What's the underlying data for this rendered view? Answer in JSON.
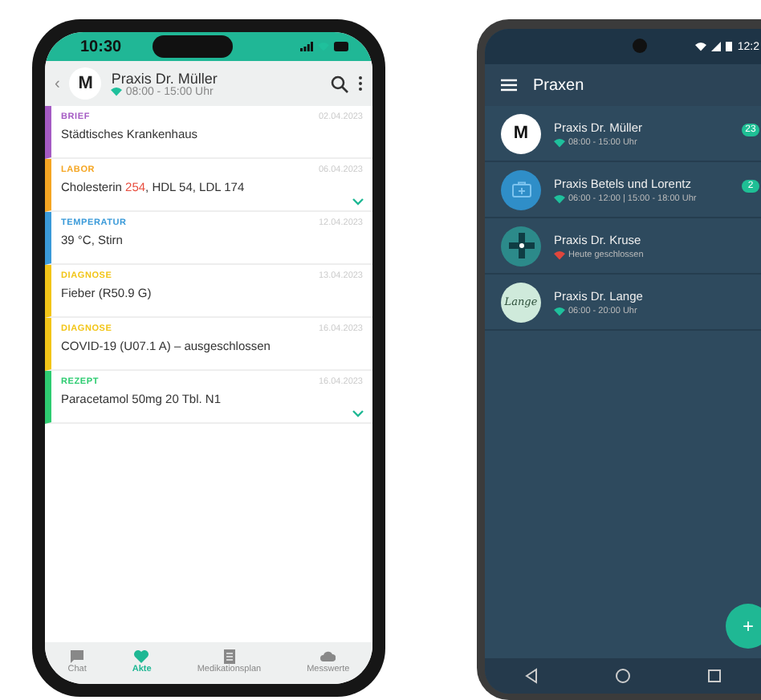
{
  "phone_left": {
    "status_bar": {
      "time": "10:30"
    },
    "header": {
      "back": "‹",
      "avatar": "M",
      "title": "Praxis Dr. Müller",
      "hours": "08:00 - 15:00 Uhr",
      "open": true
    },
    "entries": [
      {
        "category": "BRIEF",
        "color": "#a55bc4",
        "date": "02.04.2023",
        "parts": [
          {
            "text": "Städtisches Krankenhaus",
            "flagged": false
          }
        ],
        "expandable": false
      },
      {
        "category": "LABOR",
        "color": "#f5a623",
        "date": "06.04.2023",
        "parts": [
          {
            "text": "Cholesterin ",
            "flagged": false
          },
          {
            "text": "254",
            "flagged": true
          },
          {
            "text": ", HDL 54, LDL 174",
            "flagged": false
          }
        ],
        "expandable": true
      },
      {
        "category": "TEMPERATUR",
        "color": "#3a9ad9",
        "date": "12.04.2023",
        "parts": [
          {
            "text": "39 °C, Stirn",
            "flagged": false
          }
        ],
        "expandable": false
      },
      {
        "category": "DIAGNOSE",
        "color": "#f2c518",
        "date": "13.04.2023",
        "parts": [
          {
            "text": "Fieber (R50.9 G)",
            "flagged": false
          }
        ],
        "expandable": false
      },
      {
        "category": "DIAGNOSE",
        "color": "#f2c518",
        "date": "16.04.2023",
        "parts": [
          {
            "text": "COVID-19 (U07.1 A) – ausgeschlossen",
            "flagged": false
          }
        ],
        "expandable": false
      },
      {
        "category": "REZEPT",
        "color": "#2ecc71",
        "date": "16.04.2023",
        "parts": [
          {
            "text": "Paracetamol 50mg 20 Tbl. N1",
            "flagged": false
          }
        ],
        "expandable": true
      }
    ],
    "tabs": [
      {
        "kind": "chat",
        "label": "Chat",
        "selected": false
      },
      {
        "kind": "heart",
        "label": "Akte",
        "selected": true
      },
      {
        "kind": "list",
        "label": "Medikationsplan",
        "selected": false
      },
      {
        "kind": "cloud",
        "label": "Messwerte",
        "selected": false
      }
    ]
  },
  "phone_right": {
    "status_bar": {
      "time": "12:2"
    },
    "title": "Praxen",
    "practices": [
      {
        "kind": "letter",
        "avatar_text": "M",
        "name": "Praxis Dr. Müller",
        "hours": "08:00 - 15:00 Uhr",
        "open": true,
        "badge": "23"
      },
      {
        "kind": "case",
        "name": "Praxis Betels und Lorentz",
        "hours": "06:00 - 12:00 | 15:00 - 18:00 Uhr",
        "open": true,
        "badge": "2"
      },
      {
        "kind": "cross",
        "name": "Praxis Dr. Kruse",
        "hours": "Heute geschlossen",
        "open": false
      },
      {
        "kind": "logo",
        "avatar_text": "Lange",
        "name": "Praxis Dr. Lange",
        "hours": "06:00 - 20:00 Uhr",
        "open": true
      }
    ],
    "fab": "+"
  }
}
